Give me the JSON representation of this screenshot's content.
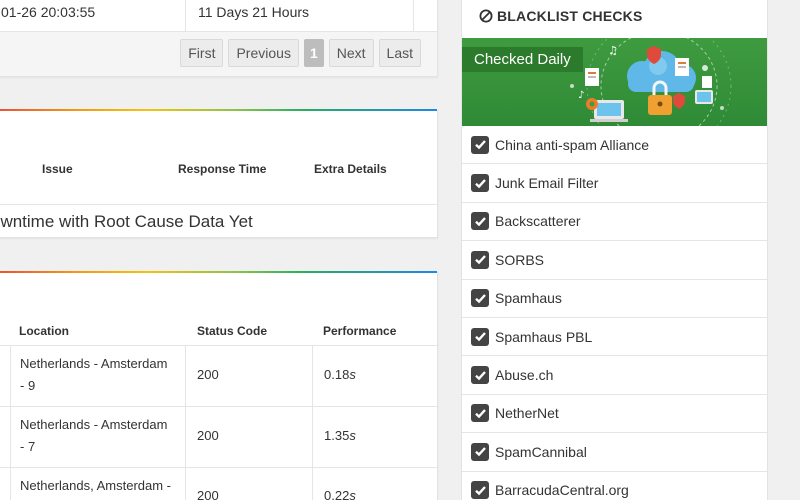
{
  "incidents_panel": {
    "start_date": "01-26 20:03:55",
    "duration": "11 Days 21 Hours",
    "pagination": {
      "first": "First",
      "previous": "Previous",
      "current": "1",
      "next": "Next",
      "last": "Last"
    }
  },
  "root_cause_panel": {
    "columns": {
      "issue": "Issue",
      "response_time": "Response Time",
      "extra_details": "Extra Details"
    },
    "empty_message": "owntime with Root Cause Data Yet"
  },
  "checks_panel": {
    "columns": {
      "location": "Location",
      "status_code": "Status Code",
      "performance": "Performance"
    },
    "rows": [
      {
        "location_line1": "Netherlands - Amsterdam",
        "location_line2": "- 9",
        "status": "200",
        "perf_value": "0.18",
        "perf_unit": "s"
      },
      {
        "location_line1": "Netherlands - Amsterdam",
        "location_line2": "- 7",
        "status": "200",
        "perf_value": "1.35",
        "perf_unit": "s"
      },
      {
        "location_line1": "Netherlands, Amsterdam -",
        "location_line2": "",
        "status": "200",
        "perf_value": "0.22",
        "perf_unit": "s"
      }
    ]
  },
  "blacklist": {
    "title": "BLACKLIST CHECKS",
    "banner_label": "Checked Daily",
    "items": [
      "China anti-spam Alliance",
      "Junk Email Filter",
      "Backscatterer",
      "SORBS",
      "Spamhaus",
      "Spamhaus PBL",
      "Abuse.ch",
      "NetherNet",
      "SpamCannibal",
      "BarracudaCentral.org"
    ]
  },
  "colors": {
    "banner_green": "#3f9b3f",
    "badge_green": "#2c7a2c",
    "checkbox": "#444444",
    "cloud": "#5fb8e8",
    "lock": "#f0a030"
  }
}
